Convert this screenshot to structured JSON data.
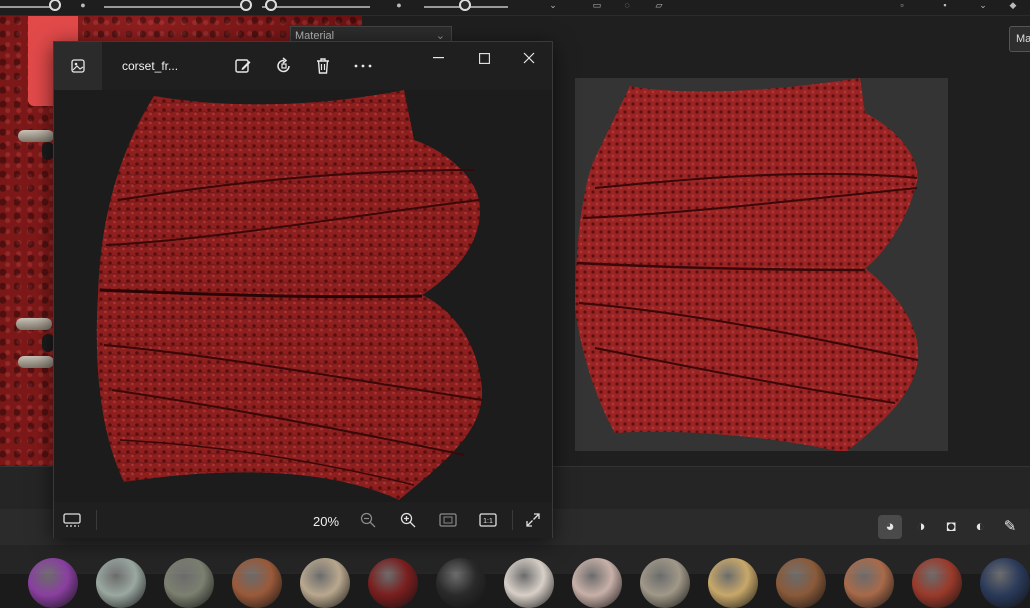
{
  "background_app": {
    "material_dropdown": {
      "value": "Material"
    },
    "material_chip": {
      "value": "Ma"
    },
    "mode_buttons": [
      {
        "icon": "shaded-sphere-icon",
        "active": true
      },
      {
        "icon": "half-sphere-icon",
        "active": false
      },
      {
        "icon": "square-frame-icon",
        "active": false
      },
      {
        "icon": "contrast-circle-icon",
        "active": false
      },
      {
        "icon": "brush-icon",
        "active": false
      }
    ],
    "material_swatches": [
      "#8a3fa0",
      "#9aa8a0",
      "#7b8070",
      "#9a5a3a",
      "#b9a88e",
      "#7a1e1e",
      "#2a2a2a",
      "#d8d0c8",
      "#c8b0a8",
      "#a09888",
      "#c8a86a",
      "#8a5a3a",
      "#a86a4a",
      "#9a3a2a",
      "#2a3a5a"
    ]
  },
  "viewer": {
    "file_name": "corset_fr...",
    "zoom_level": "20%",
    "colors": {
      "fabric": "#8e1f1f",
      "fabric_dark": "#5a0f0f",
      "seam": "#3a0808",
      "canvas": "#1c1c1c"
    },
    "toolbar_icons": [
      "edit-image-icon",
      "rotate-icon",
      "delete-icon",
      "more-icon"
    ],
    "window_icons": [
      "minimize-icon",
      "maximize-icon",
      "close-icon"
    ],
    "footer_icons": [
      "filmstrip-icon",
      "zoom-out-icon",
      "zoom-in-icon",
      "fit-to-window-icon",
      "actual-size-icon",
      "fullscreen-icon"
    ],
    "actual_size_label": "1:1"
  }
}
